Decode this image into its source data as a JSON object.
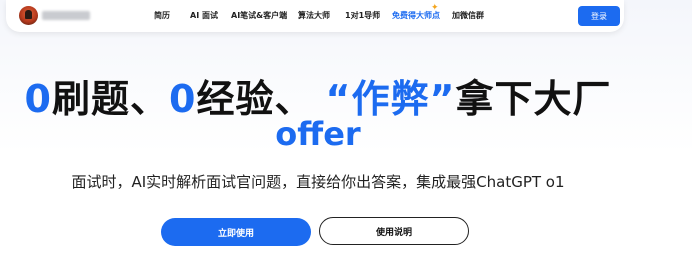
{
  "nav": {
    "items": [
      "简历",
      "AI 面试",
      "AI笔试&客户端",
      "算法大师",
      "1对1导师",
      "免费得大师点",
      "加微信群"
    ],
    "login_label": "登录"
  },
  "hero": {
    "headline_parts": [
      "0",
      "刷题、",
      "0",
      "经验、",
      "“作弊”",
      "拿下大厂"
    ],
    "offer": "offer",
    "subtitle": "面试时，AI实时解析面试官问题，直接给你出答案，集成最强ChatGPT o1",
    "primary_button": "立即使用",
    "secondary_button": "使用说明"
  },
  "colors": {
    "accent": "#1c6bf0",
    "promo_spark": "#f4a51c"
  },
  "icons": {
    "logo": "avatar-logo-icon",
    "spark": "sparkle-icon"
  }
}
